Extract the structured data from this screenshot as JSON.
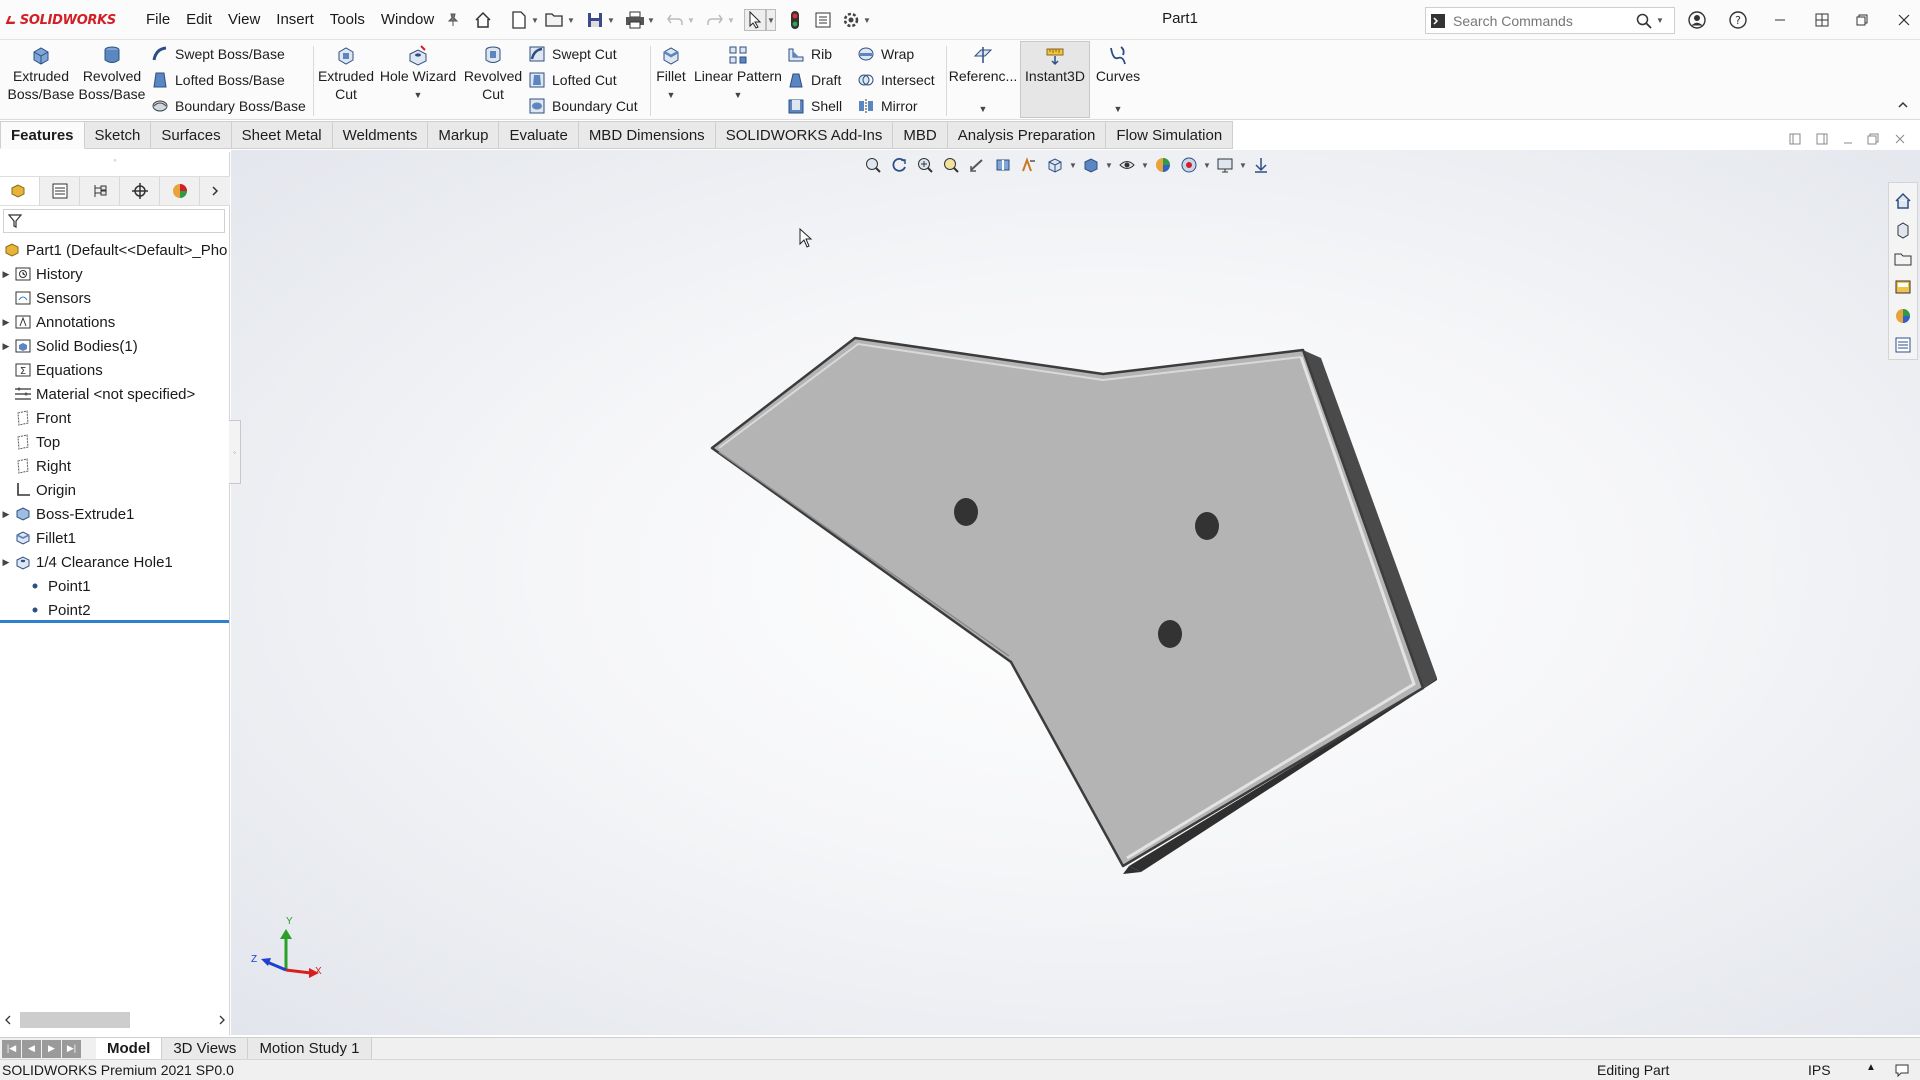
{
  "app": {
    "logo_text": "SOLIDWORKS",
    "document_title": "Part1"
  },
  "menu": {
    "items": [
      "File",
      "Edit",
      "View",
      "Insert",
      "Tools",
      "Window"
    ]
  },
  "search": {
    "placeholder": "Search Commands"
  },
  "ribbon": {
    "extruded_boss": "Extruded Boss/Base",
    "revolved_boss": "Revolved Boss/Base",
    "swept_boss": "Swept Boss/Base",
    "lofted_boss": "Lofted Boss/Base",
    "boundary_boss": "Boundary Boss/Base",
    "extruded_cut": "Extruded Cut",
    "hole_wizard": "Hole Wizard",
    "revolved_cut": "Revolved Cut",
    "swept_cut": "Swept Cut",
    "lofted_cut": "Lofted Cut",
    "boundary_cut": "Boundary Cut",
    "fillet": "Fillet",
    "linear_pattern": "Linear Pattern",
    "rib": "Rib",
    "draft": "Draft",
    "shell": "Shell",
    "wrap": "Wrap",
    "intersect": "Intersect",
    "mirror": "Mirror",
    "reference": "Referenc...",
    "instant3d": "Instant3D",
    "curves": "Curves"
  },
  "tabs": [
    "Features",
    "Sketch",
    "Surfaces",
    "Sheet Metal",
    "Weldments",
    "Markup",
    "Evaluate",
    "MBD Dimensions",
    "SOLIDWORKS Add-Ins",
    "MBD",
    "Analysis Preparation",
    "Flow Simulation"
  ],
  "feature_tree": {
    "root": "Part1  (Default<<Default>_Pho",
    "items": [
      {
        "label": "History",
        "icon": "history-icon",
        "expandable": true
      },
      {
        "label": "Sensors",
        "icon": "sensors-icon",
        "expandable": false
      },
      {
        "label": "Annotations",
        "icon": "annotations-icon",
        "expandable": true
      },
      {
        "label": "Solid Bodies(1)",
        "icon": "solid-bodies-icon",
        "expandable": true
      },
      {
        "label": "Equations",
        "icon": "equations-icon",
        "expandable": false
      },
      {
        "label": "Material <not specified>",
        "icon": "material-icon",
        "expandable": false
      },
      {
        "label": "Front",
        "icon": "plane-icon",
        "expandable": false
      },
      {
        "label": "Top",
        "icon": "plane-icon",
        "expandable": false
      },
      {
        "label": "Right",
        "icon": "plane-icon",
        "expandable": false
      },
      {
        "label": "Origin",
        "icon": "origin-icon",
        "expandable": false
      },
      {
        "label": "Boss-Extrude1",
        "icon": "boss-extrude-icon",
        "expandable": true
      },
      {
        "label": "Fillet1",
        "icon": "fillet-icon",
        "expandable": false
      },
      {
        "label": "1/4 Clearance Hole1",
        "icon": "hole-icon",
        "expandable": true
      },
      {
        "label": "Point1",
        "icon": "point-icon",
        "expandable": false
      },
      {
        "label": "Point2",
        "icon": "point-icon",
        "expandable": false
      }
    ]
  },
  "triad": {
    "x": "X",
    "y": "Y",
    "z": "Z"
  },
  "bottom_tabs": [
    "Model",
    "3D Views",
    "Motion Study 1"
  ],
  "status": {
    "version": "SOLIDWORKS Premium 2021 SP0.0",
    "mode": "Editing Part",
    "units": "IPS"
  },
  "colors": {
    "brand_red": "#d21f26",
    "accent_blue": "#2f7fd0",
    "part_face": "#b4b4b4",
    "part_edge": "#3c3c3c"
  }
}
